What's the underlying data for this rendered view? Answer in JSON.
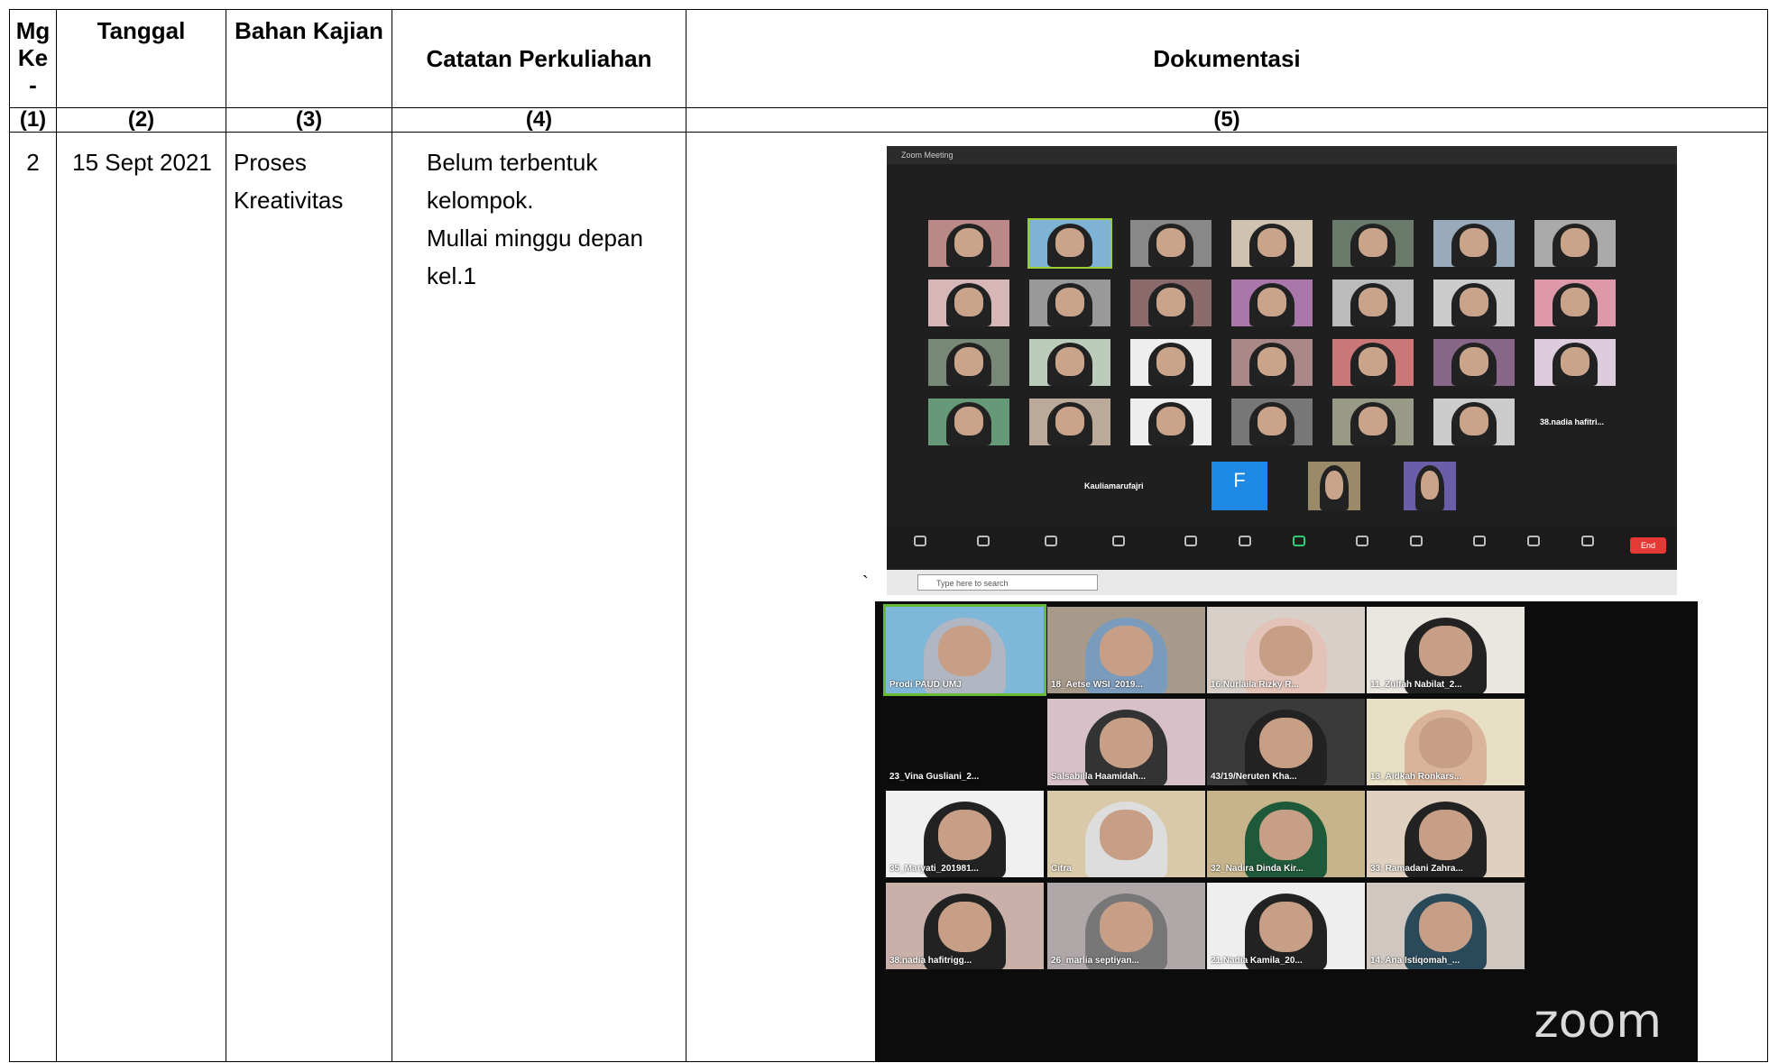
{
  "headers": {
    "col1": "Mg Ke -",
    "col1_lines": [
      "Mg",
      "Ke",
      "-"
    ],
    "col2": "Tanggal",
    "col3": "Bahan Kajian",
    "col4": "Catatan Perkuliahan",
    "col5": "Dokumentasi"
  },
  "numbers": [
    "(1)",
    "(2)",
    "(3)",
    "(4)",
    "(5)"
  ],
  "row": {
    "week": "2",
    "date": "15 Sept 2021",
    "topic_line1": "Proses",
    "topic_line2": "Kreativitas",
    "notes_line1": "Belum terbentuk kelompok.",
    "notes_line2": "Mullai minggu depan kel.1"
  },
  "shot1": {
    "title": "Zoom Meeting",
    "name_tile": "Kauliamarufajri",
    "f_tile": "F",
    "name_tile2": "38.nadia hafitri...",
    "end": "End",
    "search": "Type here to search",
    "stray": "`"
  },
  "shot2": {
    "labels": [
      "Prodi PAUD UMJ",
      "18_Aetse WSI_2019...",
      "16.Nurlaila Rizky R...",
      "11_Zulfah Nabilat_2...",
      "23_Vina Gusliani_2...",
      "Salsabilla Haamidah...",
      "43/19/Neruten Kha...",
      "13_Aidkah Ronkars...",
      "35_Maryati_201981...",
      "Citra",
      "32_Nadira Dinda Kir...",
      "33. Ramadani Zahra...",
      "38.nadia hafitrigg...",
      "26_marlia septiyan...",
      "21.Nadia Kamila_20...",
      "14. Ana Istiqomah_..."
    ],
    "watermark": "zoom"
  }
}
